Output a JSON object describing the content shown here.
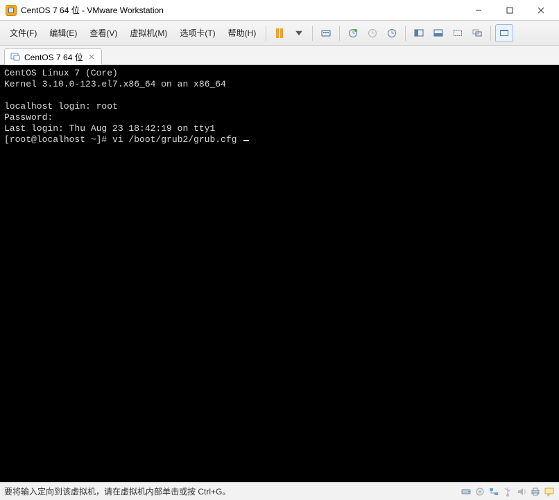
{
  "window": {
    "title": "CentOS 7 64 位 - VMware Workstation"
  },
  "menu": {
    "file": "文件(F)",
    "edit": "编辑(E)",
    "view": "查看(V)",
    "vm": "虚拟机(M)",
    "tabs": "选项卡(T)",
    "help": "帮助(H)"
  },
  "tab": {
    "label": "CentOS 7 64 位"
  },
  "terminal": {
    "line1": "CentOS Linux 7 (Core)",
    "line2": "Kernel 3.10.0-123.el7.x86_64 on an x86_64",
    "blank1": "",
    "line3": "localhost login: root",
    "line4": "Password:",
    "line5": "Last login: Thu Aug 23 18:42:19 on tty1",
    "line6": "[root@localhost ~]# vi /boot/grub2/grub.cfg "
  },
  "status": {
    "message": "要将输入定向到该虚拟机，请在虚拟机内部单击或按 Ctrl+G。"
  }
}
